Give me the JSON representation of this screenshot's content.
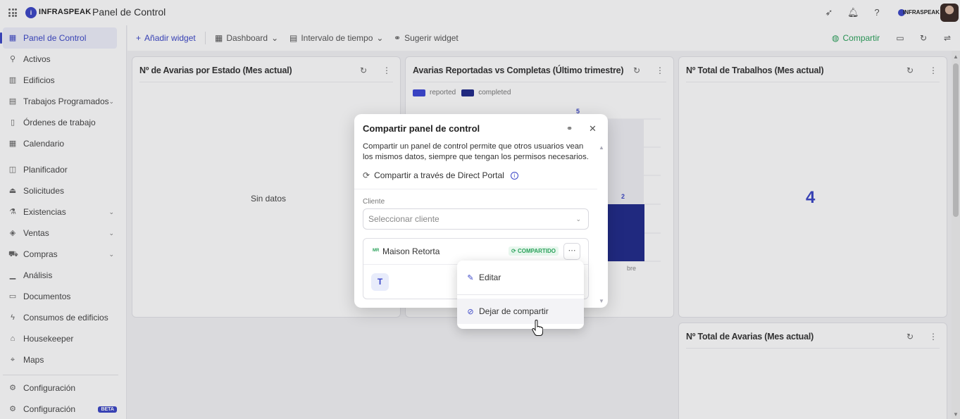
{
  "header": {
    "brand": "INFRASPEAK",
    "app_title": "Panel de Control",
    "org_name": "INFRASPEAK"
  },
  "sidebar": {
    "items": [
      {
        "label": "Panel de Control",
        "icon": "dashboard-icon"
      },
      {
        "label": "Activos",
        "icon": "asset-icon"
      },
      {
        "label": "Edificios",
        "icon": "building-icon"
      },
      {
        "label": "Trabajos Programados",
        "icon": "calendar-work-icon"
      },
      {
        "label": "Órdenes de trabajo",
        "icon": "clipboard-icon"
      },
      {
        "label": "Calendario",
        "icon": "calendar-icon"
      },
      {
        "label": "Planificador",
        "icon": "planner-icon"
      },
      {
        "label": "Solicitudes",
        "icon": "inbox-icon"
      },
      {
        "label": "Existencias",
        "icon": "stock-icon"
      },
      {
        "label": "Ventas",
        "icon": "tag-icon"
      },
      {
        "label": "Compras",
        "icon": "cart-icon"
      },
      {
        "label": "Análisis",
        "icon": "chart-icon"
      },
      {
        "label": "Documentos",
        "icon": "document-icon"
      },
      {
        "label": "Consumos de edificios",
        "icon": "bolt-icon"
      },
      {
        "label": "Housekeeper",
        "icon": "home-icon"
      },
      {
        "label": "Maps",
        "icon": "pin-icon"
      },
      {
        "label": "Configuración",
        "icon": "gear-icon"
      },
      {
        "label": "Configuración",
        "icon": "gear-icon",
        "badge": "BETA"
      }
    ]
  },
  "toolbar": {
    "add_widget": "Añadir widget",
    "dashboard": "Dashboard",
    "time_interval": "Intervalo de tiempo",
    "suggest_widget": "Sugerir widget",
    "share": "Compartir"
  },
  "cards": {
    "by_state": {
      "title": "Nº de Avarias por Estado (Mes actual)",
      "empty_text": "Sin datos"
    },
    "reported_vs_completed": {
      "title": "Avarias Reportadas vs Completas (Último trimestre)"
    },
    "total_jobs": {
      "title": "Nº Total de Trabalhos (Mes actual)",
      "value": "4"
    },
    "total_failures": {
      "title": "Nº Total de Avarias (Mes actual)"
    }
  },
  "chart_data": {
    "type": "bar",
    "series": [
      {
        "name": "reported",
        "color": "#3b46d6"
      },
      {
        "name": "completed",
        "color": "#1f2a8a"
      }
    ],
    "visible_value_labels": [
      "5",
      "2"
    ],
    "visible_tick_fragment": "bre"
  },
  "share_modal": {
    "title": "Compartir panel de control",
    "description": "Compartir un panel de control permite que otros usuarios vean los mismos datos, siempre que tengan los permisos necesarios.",
    "direct_portal": "Compartir a través de Direct Portal",
    "client_label": "Cliente",
    "client_placeholder": "Seleccionar cliente",
    "shared_client": {
      "initials": "MR",
      "name": "Maison Retorta",
      "status": "COMPARTIDO"
    },
    "user_initial": "T"
  },
  "dropdown_menu": {
    "edit": "Editar",
    "stop_sharing": "Dejar de compartir"
  },
  "colors": {
    "accent": "#3b46c7",
    "success": "#2aa15a"
  }
}
